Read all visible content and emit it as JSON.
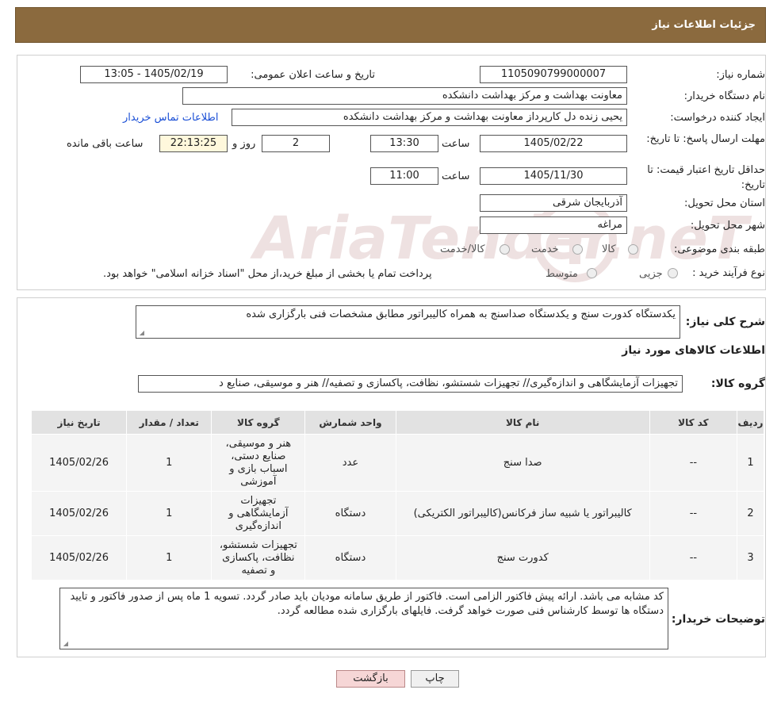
{
  "header": {
    "title": "جزئیات اطلاعات نیاز"
  },
  "form": {
    "need_number_label": "شماره نیاز:",
    "need_number": "1105090799000007",
    "announce_label": "تاریخ و ساعت اعلان عمومی:",
    "announce_value": "1405/02/19 - 13:05",
    "buyer_org_label": "نام دستگاه خریدار:",
    "buyer_org": "معاونت بهداشت و مرکز بهداشت دانشکده",
    "creator_label": "ایجاد کننده درخواست:",
    "creator": "یحیی زنده دل کارپرداز معاونت بهداشت و مرکز بهداشت دانشکده",
    "contact_link": "اطلاعات تماس خریدار",
    "reply_deadline_label": "مهلت ارسال پاسخ: تا تاریخ:",
    "reply_date": "1405/02/22",
    "time_label": "ساعت",
    "reply_time": "13:30",
    "days_value": "2",
    "days_label": "روز و",
    "remaining_time": "22:13:25",
    "remaining_label": "ساعت باقی مانده",
    "price_validity_label": "حداقل تاریخ اعتبار قیمت: تا تاریخ:",
    "price_date": "1405/11/30",
    "price_time": "11:00",
    "province_label": "استان محل تحویل:",
    "province": "آذربایجان شرقی",
    "city_label": "شهر محل تحویل:",
    "city": "مراغه",
    "category_label": "طبقه بندی موضوعی:",
    "category_options": [
      "کالا",
      "خدمت",
      "کالا/خدمت"
    ],
    "process_label": "نوع فرآیند خرید :",
    "process_options": [
      "جزیی",
      "متوسط"
    ],
    "process_note": "پرداخت تمام یا بخشی از مبلغ خرید،از محل \"اسناد خزانه اسلامی\" خواهد بود."
  },
  "details": {
    "summary_label": "شرح کلی نیاز:",
    "summary": "یکدستگاه کدورت سنج و یکدستگاه صداسنج به همراه کالیبراتور مطابق مشخصات فنی بارگزاری شده",
    "goods_info_title": "اطلاعات کالاهای مورد نیاز",
    "goods_group_label": "گروه کالا:",
    "goods_group": "تجهیزات آزمایشگاهی و اندازه‌گیری// تجهیزات شستشو، نظافت، پاکسازی و تصفیه// هنر و موسیقی، صنایع د"
  },
  "table": {
    "headers": [
      "ردیف",
      "کد کالا",
      "نام کالا",
      "واحد شمارش",
      "گروه کالا",
      "تعداد / مقدار",
      "تاریخ نیاز"
    ],
    "rows": [
      [
        "1",
        "--",
        "صدا سنج",
        "عدد",
        "هنر و موسیقی، صنایع دستی، اسباب بازی و آموزشی",
        "1",
        "1405/02/26"
      ],
      [
        "2",
        "--",
        "کالیبراتور یا شبیه ساز فرکانس(کالیبراتور الکتریکی)",
        "دستگاه",
        "تجهیزات آزمایشگاهی و اندازه‌گیری",
        "1",
        "1405/02/26"
      ],
      [
        "3",
        "--",
        "کدورت سنج",
        "دستگاه",
        "تجهیزات شستشو، نظافت، پاکسازی و تصفیه",
        "1",
        "1405/02/26"
      ]
    ]
  },
  "notes": {
    "label": "توضیحات خریدار:",
    "text": "کد مشابه می باشد. ارائه پیش فاکتور الزامی است. فاکتور از طریق سامانه مودیان باید صادر گردد. تسویه 1 ماه پس از صدور فاکتور و تایید دستگاه ها توسط کارشناس فنی صورت خواهد گرفت. فایلهای بارگزاری شده مطالعه گردد."
  },
  "buttons": {
    "print": "چاپ",
    "back": "بازگشت"
  },
  "watermark": {
    "text": "AriaTender.neT"
  },
  "colors": {
    "header_bg": "#8b6a3e",
    "link": "#1a4fd6",
    "back_btn": "#f6d6d6"
  }
}
